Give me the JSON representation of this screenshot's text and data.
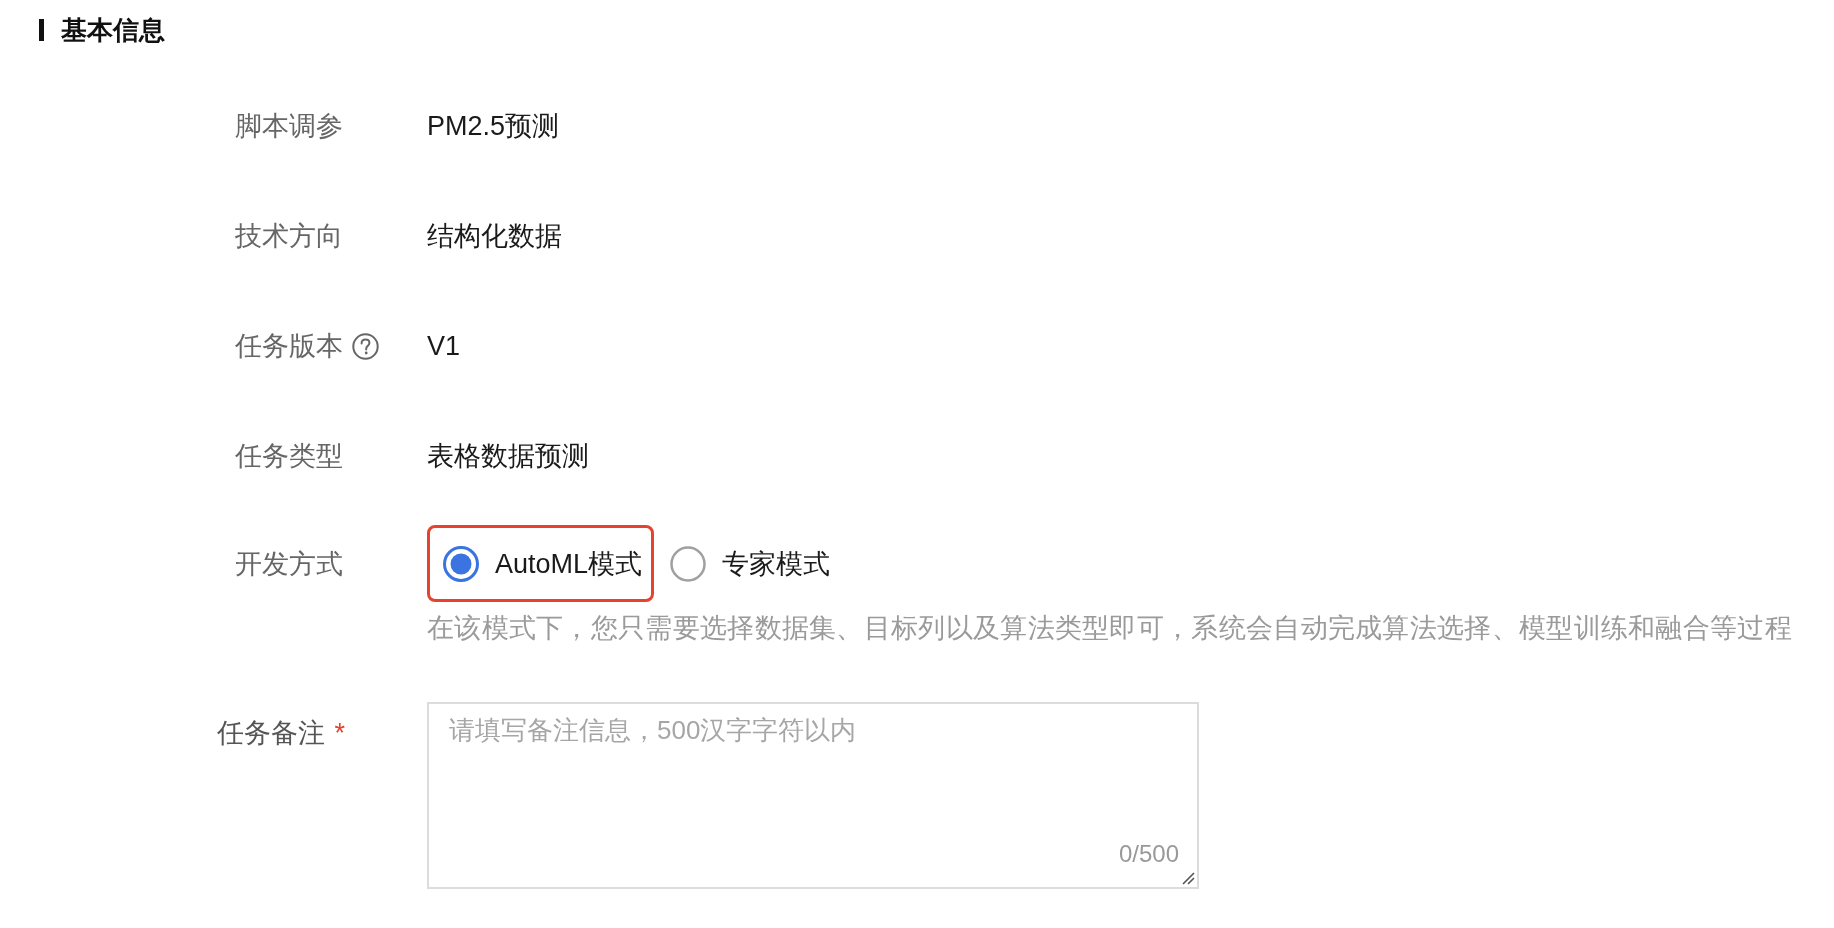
{
  "section": {
    "title": "基本信息"
  },
  "fields": [
    {
      "label": "脚本调参",
      "value": "PM2.5预测",
      "help": false
    },
    {
      "label": "技术方向",
      "value": "结构化数据",
      "help": false
    },
    {
      "label": "任务版本",
      "value": "V1",
      "help": true
    },
    {
      "label": "任务类型",
      "value": "表格数据预测",
      "help": false
    }
  ],
  "dev_mode": {
    "label": "开发方式",
    "options": [
      {
        "label": "AutoML模式",
        "selected": true,
        "highlighted": true
      },
      {
        "label": "专家模式",
        "selected": false,
        "highlighted": false
      }
    ],
    "hint": "在该模式下，您只需要选择数据集、目标列以及算法类型即可，系统会自动完成算法选择、模型训练和融合等过程"
  },
  "remark": {
    "label": "任务备注",
    "required_mark": "*",
    "placeholder": "请填写备注信息，500汉字字符以内",
    "counter": "0/500"
  }
}
